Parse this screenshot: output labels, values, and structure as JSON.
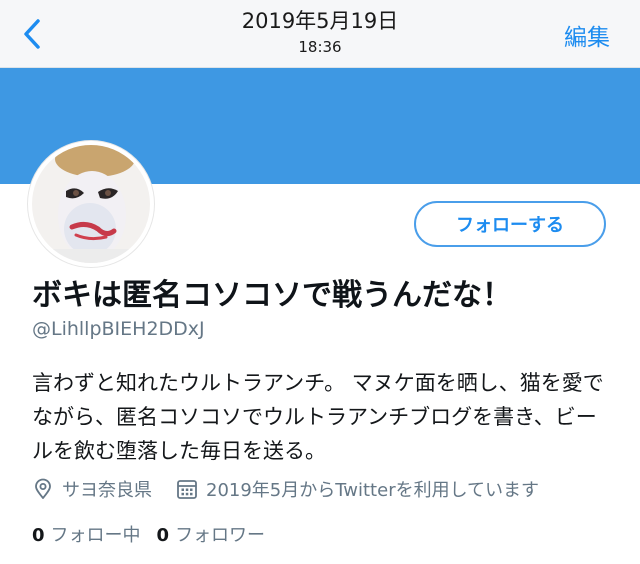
{
  "nav": {
    "date": "2019年5月19日",
    "time": "18:36",
    "edit_label": "編集",
    "back_icon": "chevron-left-icon"
  },
  "colors": {
    "accent": "#1d8cf0",
    "banner": "#3e98e3",
    "secondary_text": "#657786"
  },
  "profile": {
    "follow_label": "フォローする",
    "display_name": "ボキは匿名コソコソで戦うんだな！",
    "handle": "@LihllpBIEH2DDxJ",
    "bio": "言わずと知れたウルトラアンチ。 マヌケ面を晒し、猫を愛でながら、匿名コソコソでウルトラアンチブログを書き、ビールを飲む堕落した毎日を送る。",
    "location": "サヨ奈良県",
    "joined": "2019年5月からTwitterを利用しています",
    "following_count": "0",
    "following_label": "フォロー中",
    "followers_count": "0",
    "followers_label": "フォロワー"
  }
}
